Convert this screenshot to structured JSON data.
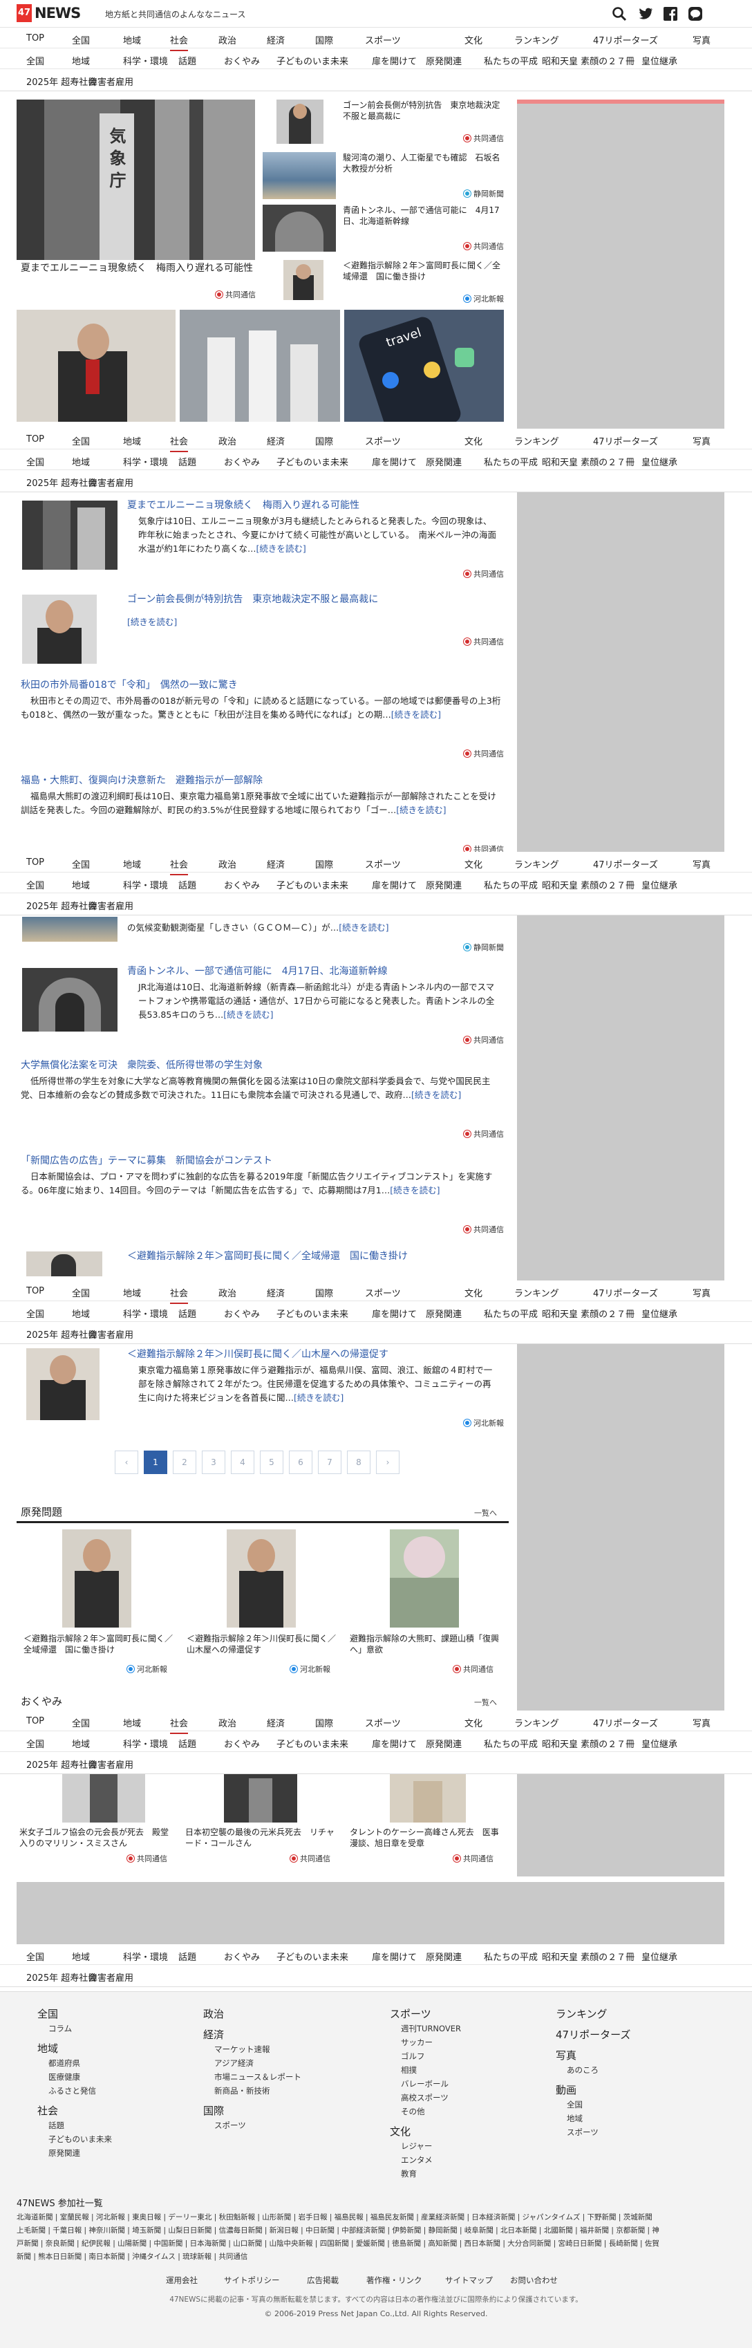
{
  "header": {
    "logo_mark": "47",
    "logo_text": "NEWS",
    "tagline": "地方紙と共同通信のよんななニュース",
    "search_icon": "search-icon",
    "twitter_icon": "twitter-icon",
    "facebook_icon": "facebook-icon",
    "line_icon": "line-icon"
  },
  "nav": {
    "main": [
      "TOP",
      "全国",
      "地域",
      "社会",
      "政治",
      "経済",
      "国際",
      "スポーツ",
      "文化",
      "ランキング",
      "47リポーターズ",
      "写真"
    ],
    "sub": [
      "全国",
      "地域",
      "科学・環境",
      "話題",
      "おくやみ",
      "子どものいま未来",
      "扉を開けて",
      "原発関連",
      "私たちの平成",
      "昭和天皇 素顔の２７冊",
      "皇位継承"
    ],
    "extra": [
      "2025年 超寿社会",
      "障害者雇用"
    ],
    "active": "社会"
  },
  "top": {
    "main_caption": "夏までエルニーニョ現象続く　梅雨入り遅れる可能性",
    "main_src": "共同通信",
    "side": [
      {
        "title": "ゴーン前会長側が特別抗告　東京地裁決定不服と最高裁に",
        "src": "共同通信"
      },
      {
        "title": "駿河湾の潮り、人工衛星でも確認　石坂名大教授が分析",
        "src": "静岡新聞"
      },
      {
        "title": "青函トンネル、一部で通信可能に　4月17日、北海道新幹線",
        "src": "共同通信"
      },
      {
        "title": "＜避難指示解除２年＞富岡町長に聞く／全域帰還　国に働き掛け",
        "src": "河北新報"
      }
    ],
    "ad_text": "travel"
  },
  "list1": [
    {
      "title": "夏までエルニーニョ現象続く　梅雨入り遅れる可能性",
      "body": "気象庁は10日、エルニーニョ現象が3月も継続したとみられると発表した。今回の現象は、昨年秋に始まったとされ、今夏にかけて続く可能性が高いとしている。　南米ペルー沖の海面水温が約1年にわたり高くな…",
      "more": "[続きを読む]",
      "src": "共同通信"
    },
    {
      "title": "ゴーン前会長側が特別抗告　東京地裁決定不服と最高裁に",
      "body": "",
      "more": "[続きを読む]",
      "src": "共同通信"
    },
    {
      "title": "秋田の市外局番018で「令和」　偶然の一致に驚き",
      "body": "秋田市とその周辺で、市外局番の018が新元号の「令和」に読めると話題になっている。一部の地域では郵便番号の上3桁も018と、偶然の一致が重なった。驚きとともに「秋田が注目を集める時代になれば」との期…",
      "more": "[続きを読む]",
      "src": "共同通信"
    },
    {
      "title": "福島・大熊町、復興向け決意新た　避難指示が一部解除",
      "body": "福島県大熊町の渡辺利綱町長は10日、東京電力福島第1原発事故で全域に出ていた避難指示が一部解除されたことを受け訓話を発表した。今回の避難解除が、町民の約3.5%が住民登録する地域に限られており「ゴー…",
      "more": "[続きを読む]",
      "src": "共同通信"
    }
  ],
  "list2": [
    {
      "title": "",
      "body": "の気候変動観測衛星「しきさい（ＧＣＯＭ—Ｃ）」が…",
      "more": "[続きを読む]",
      "src": "静岡新聞"
    },
    {
      "title": "青函トンネル、一部で通信可能に　4月17日、北海道新幹線",
      "body": "JR北海道は10日、北海道新幹線（新青森—新函館北斗）が走る青函トンネル内の一部でスマートフォンや携帯電話の通話・通信が、17日から可能になると発表した。青函トンネルの全長53.85キロのうち…",
      "more": "[続きを読む]",
      "src": "共同通信"
    },
    {
      "title": "大学無償化法案を可決　衆院委、低所得世帯の学生対象",
      "body": "低所得世帯の学生を対象に大学など高等教育機関の無償化を図る法案は10日の衆院文部科学委員会で、与党や国民民主党、日本維新の会などの賛成多数で可決された。11日にも衆院本会議で可決される見通しで、政府…",
      "more": "[続きを読む]",
      "src": "共同通信"
    },
    {
      "title": "「新聞広告の広告」テーマに募集　新聞協会がコンテスト",
      "body": "日本新聞協会は、プロ・アマを問わずに独創的な広告を募る2019年度「新聞広告クリエイティブコンテスト」を実施する。06年度に始まり、14回目。今回のテーマは「新聞広告を広告する」で、応募期間は7月1…",
      "more": "[続きを読む]",
      "src": "共同通信"
    },
    {
      "title": "＜避難指示解除２年＞富岡町長に聞く／全域帰還　国に働き掛け",
      "body": "",
      "more": "",
      "src": ""
    }
  ],
  "list3": [
    {
      "title": "＜避難指示解除２年＞川俣町長に聞く／山木屋への帰還促す",
      "body": "東京電力福島第１原発事故に伴う避難指示が、福島県川俣、富岡、浪江、飯舘の４町村で一部を除き解除されて２年がたつ。住民帰還を促進するための具体策や、コミュニティーの再生に向けた将来ビジョンを各首長に聞…",
      "more": "[続きを読む]",
      "src": "河北新報"
    }
  ],
  "pagination": [
    "1",
    "2",
    "3",
    "4",
    "5",
    "6",
    "7",
    "8"
  ],
  "genpatsu": {
    "title": "原発問題",
    "more": "一覧へ",
    "cards": [
      {
        "title": "＜避難指示解除２年＞富岡町長に聞く／全域帰還　国に働き掛け",
        "src": "河北新報"
      },
      {
        "title": "＜避難指示解除２年＞川俣町長に聞く／山木屋への帰還促す",
        "src": "河北新報"
      },
      {
        "title": "避難指示解除の大熊町、課題山積「復興へ」意欲",
        "src": "共同通信"
      }
    ]
  },
  "okuyami": {
    "title": "おくやみ",
    "more": "一覧へ",
    "cards": [
      {
        "title": "米女子ゴルフ協会の元会長が死去　殿堂入りのマリリン・スミスさん",
        "src": "共同通信"
      },
      {
        "title": "日本初空襲の最後の元米兵死去　リチャード・コールさん",
        "src": "共同通信"
      },
      {
        "title": "タレントのケーシー高峰さん死去　医事漫談、旭日章を受章",
        "src": "共同通信"
      }
    ]
  },
  "footer": {
    "cols": [
      {
        "head": "全国",
        "items": [
          "コラム"
        ],
        "head2": "地域",
        "items2": [
          "都道府県",
          "医療健康",
          "ふるさと発信"
        ],
        "head3": "社会",
        "items3": [
          "話題",
          "子どものいま未来",
          "原発関連"
        ]
      },
      {
        "head": "政治",
        "items": [],
        "head2": "経済",
        "items2": [
          "マーケット速報",
          "アジア経済",
          "市場ニュース＆レポート",
          "新商品・新技術"
        ],
        "head3": "国際",
        "items3": [
          "スポーツ"
        ]
      },
      {
        "head": "スポーツ",
        "items": [
          "週刊TURNOVER",
          "サッカー",
          "ゴルフ",
          "相撲",
          "バレーボール",
          "高校スポーツ",
          "その他"
        ],
        "head2": "文化",
        "items2": [
          "レジャー",
          "エンタメ",
          "教育"
        ]
      },
      {
        "head": "ランキング",
        "items": [],
        "head2": "47リポーターズ",
        "items2": [],
        "head3": "写真",
        "items3": [
          "あのころ"
        ],
        "head4": "動画",
        "items4": [
          "全国",
          "地域",
          "スポーツ"
        ]
      }
    ],
    "members_title": "47NEWS 参加社一覧",
    "members_line1": "北海道新聞 | 室蘭民報 | 河北新報 | 東奥日報 | デーリー東北 | 秋田魁新報 | 山形新聞 | 岩手日報 | 福島民報 | 福島民友新聞 | 産業経済新聞 | 日本経済新聞 | ジャパンタイムズ | 下野新聞 | 茨城新聞",
    "members_line2": "上毛新聞 | 千葉日報 | 神奈川新聞 | 埼玉新聞 | 山梨日日新聞 | 信濃毎日新聞 | 新潟日報 | 中日新聞 | 中部経済新聞 | 伊勢新聞 | 静岡新聞 | 岐阜新聞 | 北日本新聞 | 北國新聞 | 福井新聞 | 京都新聞 | 神",
    "members_line3": "戸新聞 | 奈良新聞 | 紀伊民報 | 山陽新聞 | 中国新聞 | 日本海新聞 | 山口新聞 | 山陰中央新報 | 四国新聞 | 愛媛新聞 | 徳島新聞 | 高知新聞 | 西日本新聞 | 大分合同新聞 | 宮崎日日新聞 | 長崎新聞 | 佐賀",
    "members_line4": "新聞 | 熊本日日新聞 | 南日本新聞 | 沖縄タイムス | 琉球新報 | 共同通信",
    "links": [
      "運用会社",
      "サイトポリシー",
      "広告掲載",
      "著作権・リンク",
      "サイトマップ",
      "お問い合わせ"
    ],
    "notice": "47NEWSに掲載の記事・写真の無断転載を禁じます。すべての内容は日本の著作権法並びに国際条約により保護されています。",
    "copyright": "© 2006-2019 Press Net Japan Co.,Ltd. All Rights Reserved."
  },
  "colors": {
    "accent": "#c62828",
    "link": "#2e5aa8",
    "page_active": "#2f5fa6"
  }
}
